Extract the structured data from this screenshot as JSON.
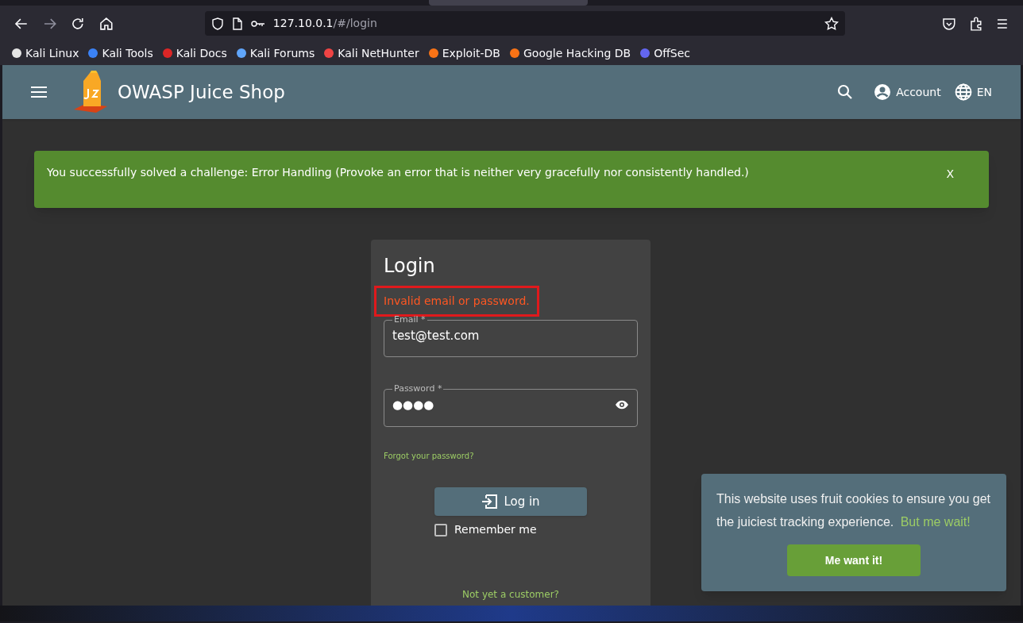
{
  "browser": {
    "url_host": "127.10.0.1",
    "url_path": "/#/login",
    "bookmarks": [
      {
        "label": "Kali Linux",
        "color": "#e5e5e5"
      },
      {
        "label": "Kali Tools",
        "color": "#3b82f6"
      },
      {
        "label": "Kali Docs",
        "color": "#dc2626"
      },
      {
        "label": "Kali Forums",
        "color": "#60a5fa"
      },
      {
        "label": "Kali NetHunter",
        "color": "#ef4444"
      },
      {
        "label": "Exploit-DB",
        "color": "#f97316"
      },
      {
        "label": "Google Hacking DB",
        "color": "#f97316"
      },
      {
        "label": "OffSec",
        "color": "#6366f1"
      }
    ]
  },
  "app": {
    "title": "OWASP Juice Shop",
    "account": "Account",
    "language": "EN"
  },
  "banner": {
    "message": "You successfully solved a challenge: Error Handling (Provoke an error that is neither very gracefully nor consistently handled.)",
    "close": "X"
  },
  "login": {
    "title": "Login",
    "error": "Invalid email or password.",
    "error_highlighted": true,
    "email": {
      "label": "Email *",
      "value": "test@test.com"
    },
    "password": {
      "label": "Password *",
      "value": "●●●●"
    },
    "forgot": "Forgot your password?",
    "button": "Log in",
    "remember": {
      "label": "Remember me",
      "checked": false
    },
    "register": "Not yet a customer?"
  },
  "cookie": {
    "message": "This website uses fruit cookies to ensure you get the juiciest tracking experience.",
    "link": "But me wait!",
    "button": "Me want it!"
  }
}
